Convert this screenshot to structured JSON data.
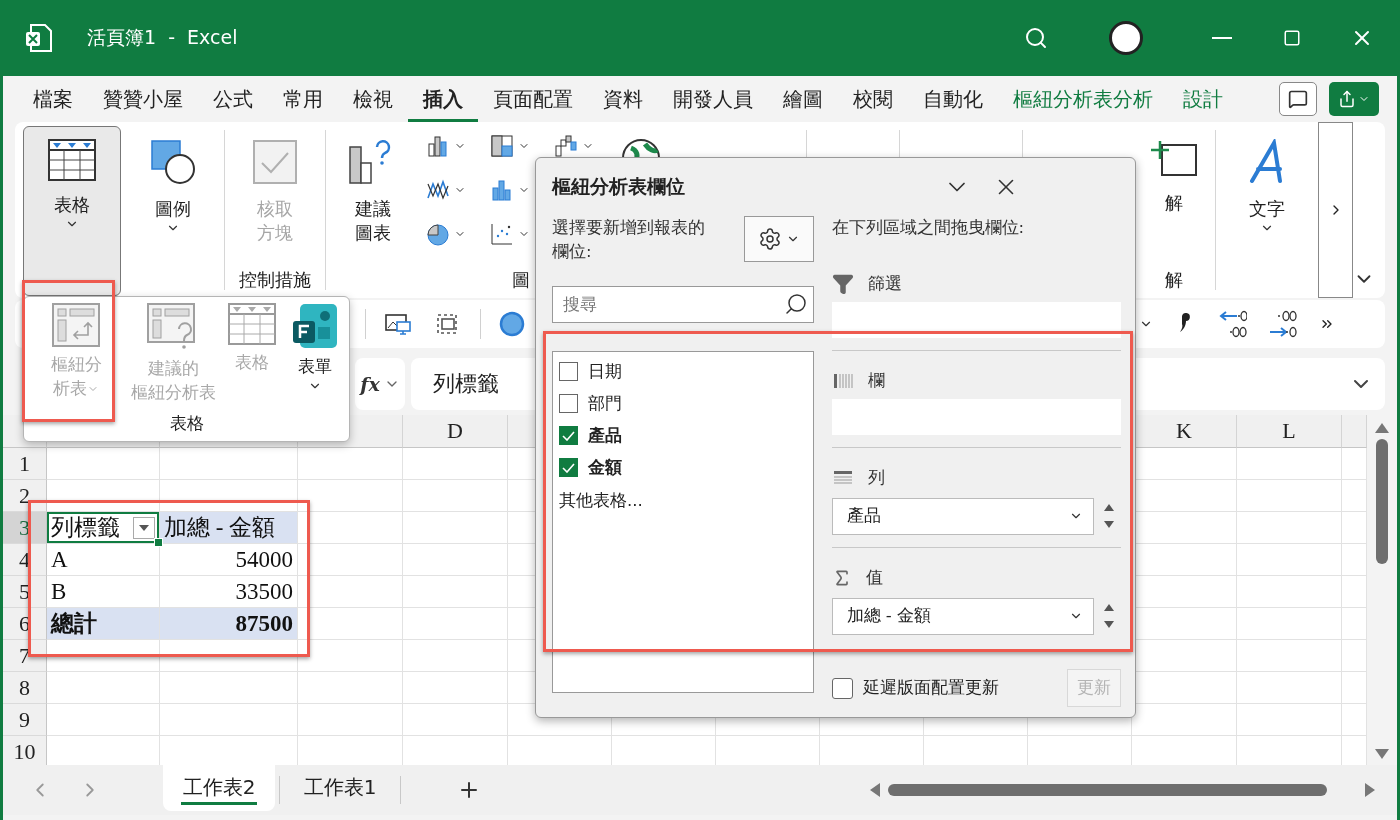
{
  "window": {
    "title": "活頁簿1  -  Excel"
  },
  "tabs": [
    {
      "label": "檔案",
      "selected": false,
      "contextual": false
    },
    {
      "label": "贊贊小屋",
      "selected": false,
      "contextual": false
    },
    {
      "label": "公式",
      "selected": false,
      "contextual": false
    },
    {
      "label": "常用",
      "selected": false,
      "contextual": false
    },
    {
      "label": "檢視",
      "selected": false,
      "contextual": false
    },
    {
      "label": "插入",
      "selected": true,
      "contextual": false
    },
    {
      "label": "頁面配置",
      "selected": false,
      "contextual": false
    },
    {
      "label": "資料",
      "selected": false,
      "contextual": false
    },
    {
      "label": "開發人員",
      "selected": false,
      "contextual": false
    },
    {
      "label": "繪圖",
      "selected": false,
      "contextual": false
    },
    {
      "label": "校閱",
      "selected": false,
      "contextual": false
    },
    {
      "label": "自動化",
      "selected": false,
      "contextual": false
    },
    {
      "label": "樞紐分析表分析",
      "selected": false,
      "contextual": true
    },
    {
      "label": "設計",
      "selected": false,
      "contextual": true
    }
  ],
  "ribbon": {
    "table_button": {
      "label": "表格",
      "pressed": true
    },
    "illustrations_button": {
      "label": "圖例"
    },
    "checkbox_button": {
      "label": "核取方塊",
      "disabled": true
    },
    "controls_group_label": "控制措施",
    "recommended_charts_button": {
      "label": "建議圖表"
    },
    "charts_group_label": "圖",
    "comments_button_label": "解",
    "comments_group_label": "解",
    "text_button": {
      "label": "文字"
    }
  },
  "table_menu": {
    "items": [
      {
        "lines": [
          "樞紐分",
          "析表"
        ],
        "disabled": true,
        "has_menu": true
      },
      {
        "lines": [
          "建議的",
          "樞紐分析表"
        ],
        "disabled": true,
        "has_menu": false
      },
      {
        "lines": [
          "表格"
        ],
        "disabled": true,
        "has_menu": false
      },
      {
        "lines": [
          "表單"
        ],
        "disabled": false,
        "has_menu": true
      }
    ],
    "group_label": "表格"
  },
  "formula_bar": {
    "function_label": "fx",
    "value": "列標籤"
  },
  "sheet": {
    "column_headers_left": [
      "D"
    ],
    "column_headers_right": [
      "K",
      "L"
    ],
    "rows": [
      {
        "number": "1",
        "selected": false
      },
      {
        "number": "2",
        "selected": false
      },
      {
        "number": "3",
        "selected": true,
        "kind": "header",
        "cells": [
          "列標籤",
          "加總 - 金額"
        ]
      },
      {
        "number": "4",
        "selected": false,
        "kind": "item",
        "cells": [
          "A",
          "54000"
        ]
      },
      {
        "number": "5",
        "selected": false,
        "kind": "item",
        "cells": [
          "B",
          "33500"
        ]
      },
      {
        "number": "6",
        "selected": false,
        "kind": "total",
        "cells": [
          "總計",
          "87500"
        ]
      },
      {
        "number": "7",
        "selected": false
      },
      {
        "number": "8",
        "selected": false
      },
      {
        "number": "9",
        "selected": false
      },
      {
        "number": "10",
        "selected": false
      }
    ]
  },
  "sheet_tabs": [
    {
      "label": "工作表2",
      "selected": true
    },
    {
      "label": "工作表1",
      "selected": false
    }
  ],
  "pivot_pane": {
    "title": "樞紐分析表欄位",
    "choose_label": "選擇要新增到報表的欄位:",
    "search": {
      "placeholder": "搜尋"
    },
    "fields": [
      {
        "label": "日期",
        "checked": false
      },
      {
        "label": "部門",
        "checked": false
      },
      {
        "label": "產品",
        "checked": true
      },
      {
        "label": "金額",
        "checked": true
      }
    ],
    "more_tables": "其他表格...",
    "drag_label": "在下列區域之間拖曳欄位:",
    "areas": [
      {
        "kind": "filters",
        "label": "篩選"
      },
      {
        "kind": "columns",
        "label": "欄"
      },
      {
        "kind": "rows",
        "label": "列",
        "items": [
          "產品"
        ]
      },
      {
        "kind": "values",
        "label": "值",
        "items": [
          "加總 - 金額"
        ]
      }
    ],
    "defer": {
      "label": "延遲版面配置更新",
      "checked": false
    },
    "update_button": {
      "label": "更新",
      "disabled": true
    }
  }
}
